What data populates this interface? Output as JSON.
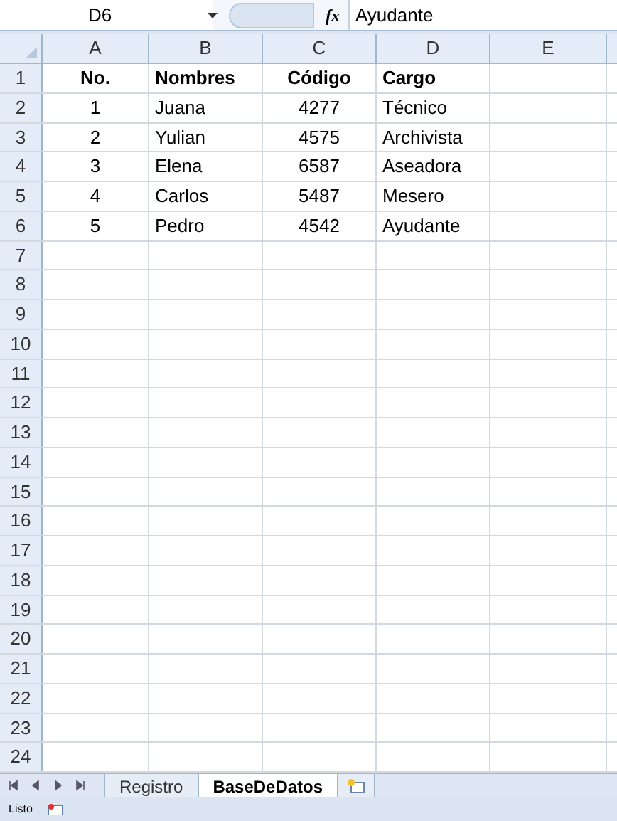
{
  "formula_bar": {
    "name_box": "D6",
    "function_label": "fx",
    "value": "Ayudante"
  },
  "columns": [
    "A",
    "B",
    "C",
    "D",
    "E"
  ],
  "rows": [
    {
      "number": "1",
      "cells": [
        "No.",
        "Nombres",
        "Código",
        "Cargo"
      ]
    },
    {
      "number": "2",
      "cells": [
        "1",
        "Juana",
        "4277",
        "Técnico"
      ]
    },
    {
      "number": "3",
      "cells": [
        "2",
        "Yulian",
        "4575",
        "Archivista"
      ]
    },
    {
      "number": "4",
      "cells": [
        "3",
        "Elena",
        "6587",
        "Aseadora"
      ]
    },
    {
      "number": "5",
      "cells": [
        "4",
        "Carlos",
        "5487",
        "Mesero"
      ]
    },
    {
      "number": "6",
      "cells": [
        "5",
        "Pedro",
        "4542",
        "Ayudante"
      ]
    },
    {
      "number": "7",
      "cells": []
    },
    {
      "number": "8",
      "cells": []
    },
    {
      "number": "9",
      "cells": []
    },
    {
      "number": "10",
      "cells": []
    },
    {
      "number": "11",
      "cells": []
    },
    {
      "number": "12",
      "cells": []
    },
    {
      "number": "13",
      "cells": []
    },
    {
      "number": "14",
      "cells": []
    },
    {
      "number": "15",
      "cells": []
    },
    {
      "number": "16",
      "cells": []
    },
    {
      "number": "17",
      "cells": []
    },
    {
      "number": "18",
      "cells": []
    },
    {
      "number": "19",
      "cells": []
    },
    {
      "number": "20",
      "cells": []
    },
    {
      "number": "21",
      "cells": []
    },
    {
      "number": "22",
      "cells": []
    },
    {
      "number": "23",
      "cells": []
    },
    {
      "number": "24",
      "cells": []
    }
  ],
  "sheet_tabs": [
    {
      "label": "Registro",
      "selected": false
    },
    {
      "label": "BaseDeDatos",
      "selected": true
    }
  ],
  "status_bar": {
    "text": "Listo"
  }
}
